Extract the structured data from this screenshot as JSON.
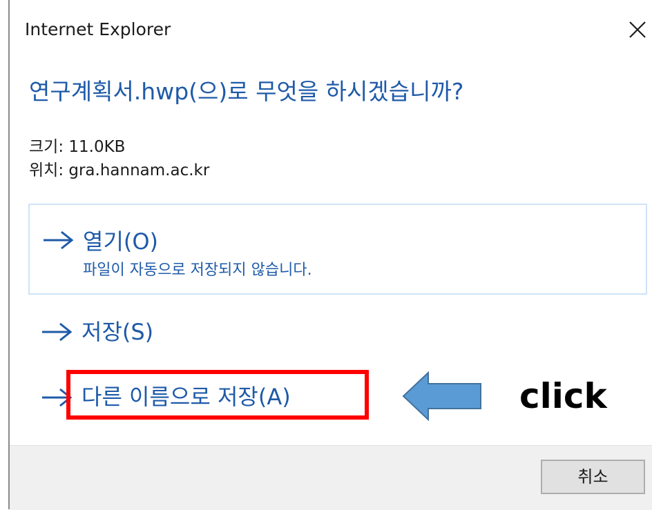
{
  "window": {
    "title": "Internet Explorer",
    "close_icon": "close-icon"
  },
  "prompt": {
    "heading": "연구계획서.hwp(으)로 무엇을 하시겠습니까?",
    "size_line": "크기: 11.0KB",
    "location_line": "위치: gra.hannam.ac.kr"
  },
  "options": {
    "open": {
      "label": "열기(O)",
      "description": "파일이 자동으로 저장되지 않습니다.",
      "icon": "arrow-right-icon"
    },
    "save": {
      "label": "저장(S)",
      "icon": "arrow-right-icon"
    },
    "save_as": {
      "label": "다른 이름으로 저장(A)",
      "icon": "arrow-right-icon"
    }
  },
  "annotation": {
    "text": "click",
    "highlight_color": "#ff0000",
    "arrow_color": "#5b9bd5"
  },
  "footer": {
    "cancel_label": "취소"
  },
  "colors": {
    "accent": "#1e5aa8",
    "open_border": "#cfe3f7",
    "footer_bg": "#f0f0f0"
  }
}
